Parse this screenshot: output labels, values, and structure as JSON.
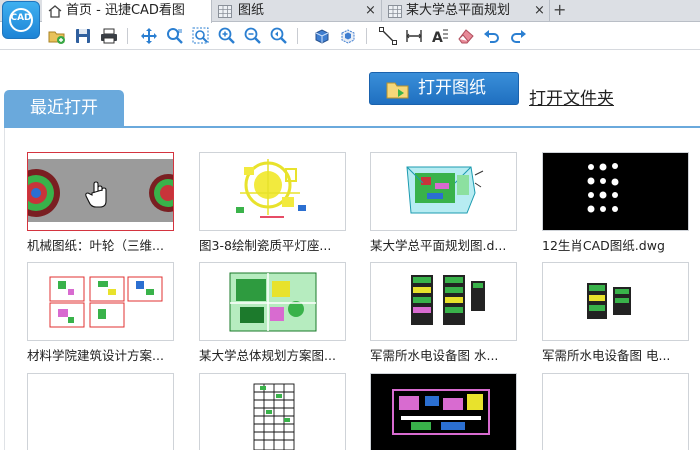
{
  "app": {
    "logo_text": "CAD"
  },
  "tabs": [
    {
      "label": "首页 - 迅捷CAD看图",
      "icon": "home-icon",
      "active": true
    },
    {
      "label": "图纸",
      "icon": "grid-doc-icon",
      "close": "×"
    },
    {
      "label": "某大学总平面规划",
      "icon": "grid-doc-icon",
      "close": "×"
    }
  ],
  "tab_add": "+",
  "toolbar": {
    "icons": [
      "open-file-icon",
      "save-icon",
      "print-icon",
      "pan-icon",
      "zoom-realtime-icon",
      "zoom-window-icon",
      "zoom-in-icon",
      "zoom-out-icon",
      "zoom-previous-icon",
      "3d-view-icon",
      "3d-orbit-icon",
      "measure-distance-icon",
      "measure-length-icon",
      "text-icon",
      "eraser-icon",
      "undo-icon",
      "redo-icon"
    ]
  },
  "actions": {
    "open_drawing": "打开图纸",
    "open_folder": "打开文件夹"
  },
  "recent": {
    "tab_label": "最近打开",
    "files": [
      {
        "name": "机械图纸：叶轮（三维...",
        "selected": true
      },
      {
        "name": "图3-8绘制瓷质平灯座..."
      },
      {
        "name": "某大学总平面规划图.d..."
      },
      {
        "name": "12生肖CAD图纸.dwg"
      },
      {
        "name": "材料学院建筑设计方案..."
      },
      {
        "name": "某大学总体规划方案图..."
      },
      {
        "name": "军需所水电设备图 水..."
      },
      {
        "name": "军需所水电设备图 电..."
      },
      {
        "name": ""
      },
      {
        "name": ""
      },
      {
        "name": ""
      },
      {
        "name": ""
      }
    ]
  },
  "colors": {
    "accent": "#1f6fc0",
    "tab_blue": "#6aa9dc",
    "selection": "#d4343f"
  }
}
